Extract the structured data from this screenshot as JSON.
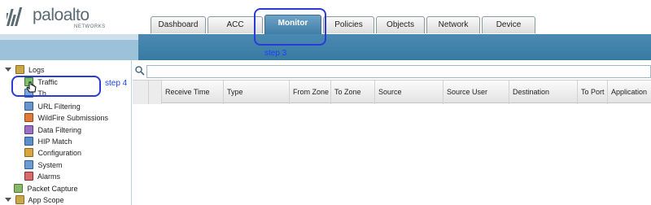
{
  "app": {
    "logo_text": "paloalto",
    "logo_subtext": "NETWORKS"
  },
  "tabs": [
    {
      "label": "Dashboard",
      "active": false
    },
    {
      "label": "ACC",
      "active": false
    },
    {
      "label": "Monitor",
      "active": true
    },
    {
      "label": "Policies",
      "active": false
    },
    {
      "label": "Objects",
      "active": false
    },
    {
      "label": "Network",
      "active": false
    },
    {
      "label": "Device",
      "active": false
    }
  ],
  "annotations": {
    "step3": "step 3",
    "step4": "step 4",
    "color": "#2a3bd6"
  },
  "sidebar": {
    "items": [
      {
        "label": "Logs",
        "icon": "folder-icon",
        "expanded": true
      },
      {
        "label": "Traffic",
        "icon": "traffic-log-icon"
      },
      {
        "label": "Th",
        "icon": "threat-log-icon"
      },
      {
        "label": "URL Filtering",
        "icon": "url-filtering-icon"
      },
      {
        "label": "WildFire Submissions",
        "icon": "wildfire-icon"
      },
      {
        "label": "Data Filtering",
        "icon": "data-filtering-icon"
      },
      {
        "label": "HIP Match",
        "icon": "hip-match-icon"
      },
      {
        "label": "Configuration",
        "icon": "configuration-icon"
      },
      {
        "label": "System",
        "icon": "system-icon"
      },
      {
        "label": "Alarms",
        "icon": "alarms-icon"
      },
      {
        "label": "Packet Capture",
        "icon": "packet-capture-icon"
      },
      {
        "label": "App Scope",
        "icon": "app-scope-icon",
        "expanded": true
      }
    ]
  },
  "log_table": {
    "columns": [
      "",
      "",
      "Receive Time",
      "Type",
      "From Zone",
      "To Zone",
      "Source",
      "Source User",
      "Destination",
      "To Port",
      "Application"
    ]
  },
  "colors": {
    "accent_blue": "#3f7ea8",
    "header_bar": "#4a8ab2",
    "annotation": "#2a3bd6"
  }
}
